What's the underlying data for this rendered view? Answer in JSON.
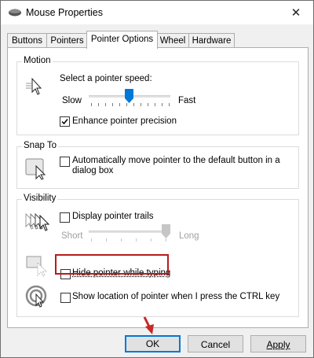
{
  "window": {
    "title": "Mouse Properties",
    "close_glyph": "✕",
    "icon": "mouse-icon"
  },
  "tabs": [
    {
      "label": "Buttons"
    },
    {
      "label": "Pointers"
    },
    {
      "label": "Pointer Options",
      "active": true
    },
    {
      "label": "Wheel"
    },
    {
      "label": "Hardware"
    }
  ],
  "motion": {
    "group_title": "Motion",
    "speed_label": "Select a pointer speed:",
    "slow_label": "Slow",
    "fast_label": "Fast",
    "speed_value_fraction": 0.5,
    "enhance_label": "Enhance pointer precision",
    "enhance_checked": true,
    "icon": "pointer-speed-icon"
  },
  "snap_to": {
    "group_title": "Snap To",
    "snap_label": "Automatically move pointer to the default button in a dialog box",
    "snap_checked": false,
    "icon": "snap-to-icon"
  },
  "visibility": {
    "group_title": "Visibility",
    "trails_label": "Display pointer trails",
    "trails_checked": false,
    "short_label": "Short",
    "long_label": "Long",
    "trails_value_fraction": 1.0,
    "hide_label": "Hide pointer while typing",
    "hide_checked": false,
    "show_label": "Show location of pointer when I press the CTRL key",
    "show_checked": false,
    "icons": [
      "pointer-trails-icon",
      "hide-pointer-icon",
      "show-location-icon"
    ]
  },
  "buttons": {
    "ok": "OK",
    "cancel": "Cancel",
    "apply": "Apply"
  },
  "accent_colors": {
    "highlight": "#b71c1c",
    "arrow": "#c62828",
    "default_button": "#0078d7",
    "thumb": "#0078d7"
  }
}
